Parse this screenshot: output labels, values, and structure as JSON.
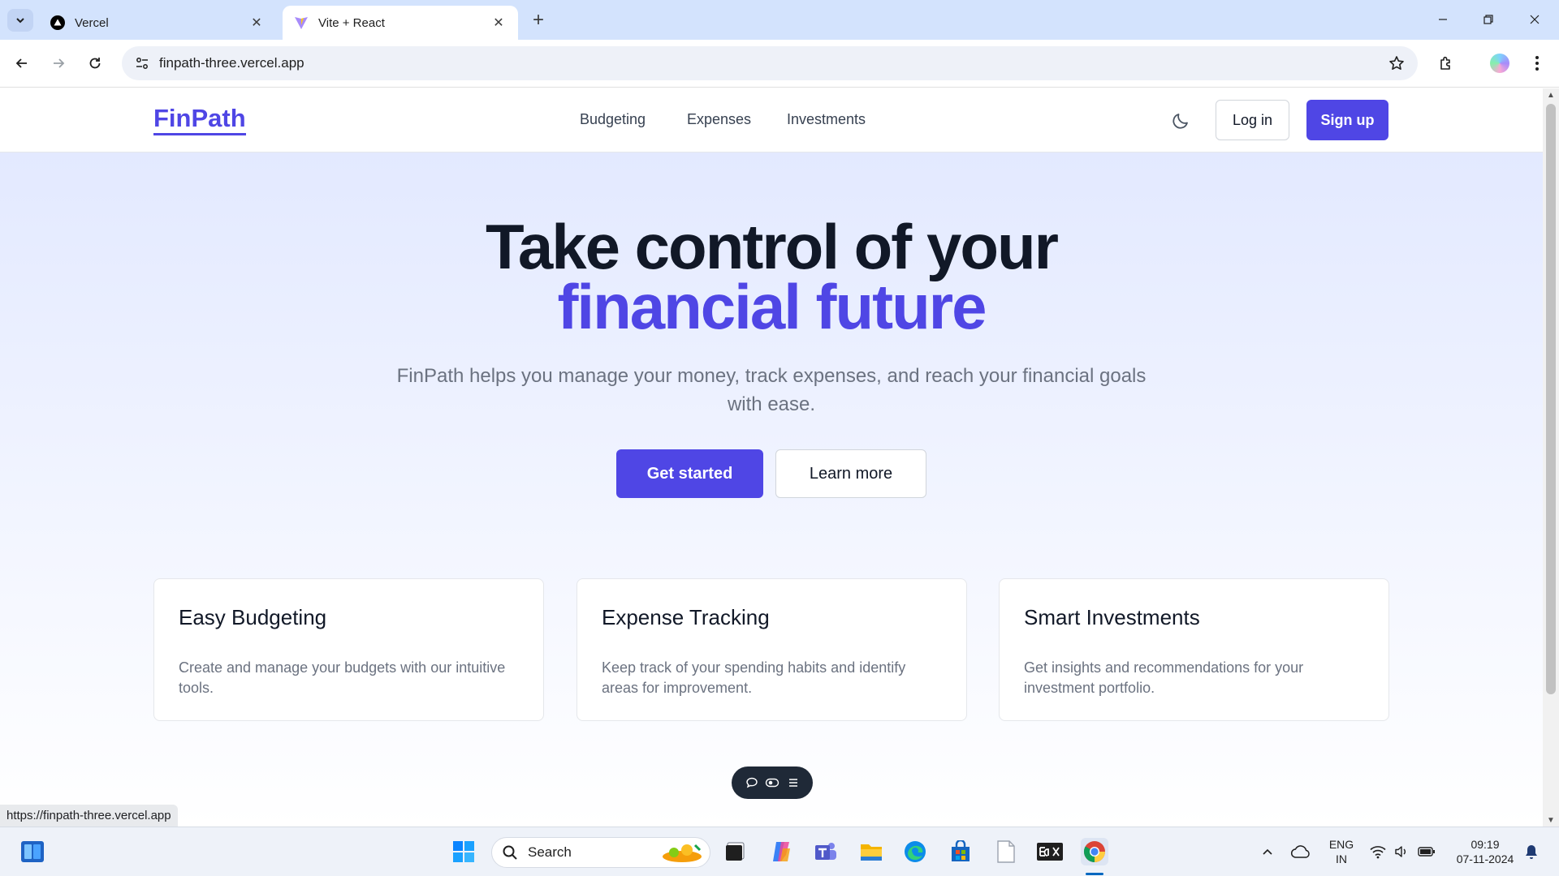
{
  "browser": {
    "tabs": [
      {
        "title": "Vercel",
        "active": false
      },
      {
        "title": "Vite + React",
        "active": true
      }
    ],
    "url": "finpath-three.vercel.app",
    "status_url": "https://finpath-three.vercel.app"
  },
  "site": {
    "logo": "FinPath",
    "nav": [
      "Budgeting",
      "Expenses",
      "Investments"
    ],
    "login_label": "Log in",
    "signup_label": "Sign up",
    "brand_color": "#4f46e5"
  },
  "hero": {
    "title_line1": "Take control of your",
    "title_line2": "financial future",
    "subtitle": "FinPath helps you manage your money, track expenses, and reach your financial goals with ease.",
    "primary_cta": "Get started",
    "secondary_cta": "Learn more"
  },
  "features": [
    {
      "title": "Easy Budgeting",
      "description": "Create and manage your budgets with our intuitive tools."
    },
    {
      "title": "Expense Tracking",
      "description": "Keep track of your spending habits and identify areas for improvement."
    },
    {
      "title": "Smart Investments",
      "description": "Get insights and recommendations for your investment portfolio."
    }
  ],
  "taskbar": {
    "search_label": "Search",
    "language": "ENG",
    "region": "IN",
    "time": "09:19",
    "date": "07-11-2024"
  }
}
